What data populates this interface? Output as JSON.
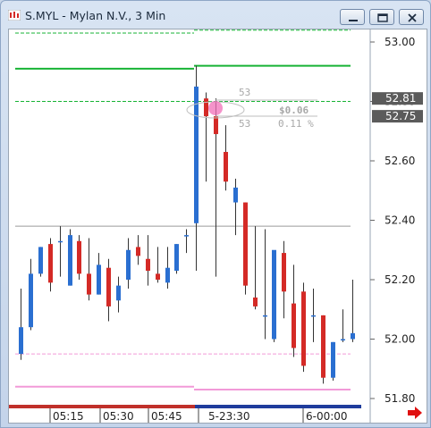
{
  "window": {
    "title": "S.MYL - Mylan N.V., 3 Min",
    "buttons": [
      "minimize",
      "maximize",
      "close"
    ]
  },
  "colors": {
    "up_candle": "#2a6fd1",
    "down_candle": "#d42a26",
    "green_level": "#17b334",
    "pink_level": "#f29ad8",
    "price_tag_bg": "#5b5b5b",
    "session_bar_red": "#c0302a",
    "session_bar_blue": "#1f3c9c",
    "arrow": "#e01010"
  },
  "chart_data": {
    "type": "candlestick",
    "symbol": "S.MYL",
    "interval": "3 Min",
    "y_axis": {
      "ylim": [
        51.76,
        53.06
      ],
      "ticks": [
        "53.00",
        "52.80",
        "52.60",
        "52.40",
        "52.20",
        "52.00",
        "51.80"
      ],
      "price_tags": [
        "52.81",
        "52.75"
      ]
    },
    "x_axis": {
      "ticks": [
        "05:15",
        "05:30",
        "05:45",
        "5-23:30",
        "6-00:00"
      ]
    },
    "candles": [
      {
        "o": 51.95,
        "h": 52.17,
        "l": 51.93,
        "c": 52.04
      },
      {
        "o": 52.04,
        "h": 52.27,
        "l": 52.03,
        "c": 52.22
      },
      {
        "o": 52.22,
        "h": 52.31,
        "l": 52.21,
        "c": 52.31
      },
      {
        "o": 52.32,
        "h": 52.34,
        "l": 52.16,
        "c": 52.19
      },
      {
        "o": 52.33,
        "h": 52.38,
        "l": 52.21,
        "c": 52.33
      },
      {
        "o": 52.18,
        "h": 52.37,
        "l": 52.18,
        "c": 52.35
      },
      {
        "o": 52.33,
        "h": 52.35,
        "l": 52.2,
        "c": 52.22
      },
      {
        "o": 52.22,
        "h": 52.34,
        "l": 52.13,
        "c": 52.15
      },
      {
        "o": 52.15,
        "h": 52.29,
        "l": 52.15,
        "c": 52.25
      },
      {
        "o": 52.24,
        "h": 52.27,
        "l": 52.06,
        "c": 52.11
      },
      {
        "o": 52.13,
        "h": 52.21,
        "l": 52.09,
        "c": 52.18
      },
      {
        "o": 52.2,
        "h": 52.34,
        "l": 52.17,
        "c": 52.3
      },
      {
        "o": 52.31,
        "h": 52.35,
        "l": 52.25,
        "c": 52.28
      },
      {
        "o": 52.27,
        "h": 52.35,
        "l": 52.18,
        "c": 52.23
      },
      {
        "o": 52.22,
        "h": 52.31,
        "l": 52.19,
        "c": 52.2
      },
      {
        "o": 52.19,
        "h": 52.31,
        "l": 52.17,
        "c": 52.24
      },
      {
        "o": 52.23,
        "h": 52.32,
        "l": 52.22,
        "c": 52.32
      },
      {
        "o": 52.35,
        "h": 52.37,
        "l": 52.29,
        "c": 52.35
      },
      {
        "o": 52.39,
        "h": 52.92,
        "l": 52.23,
        "c": 52.85
      },
      {
        "o": 52.81,
        "h": 52.83,
        "l": 52.53,
        "c": 52.75
      },
      {
        "o": 52.75,
        "h": 52.81,
        "l": 52.21,
        "c": 52.69
      },
      {
        "o": 52.63,
        "h": 52.72,
        "l": 52.5,
        "c": 52.53
      },
      {
        "o": 52.46,
        "h": 52.54,
        "l": 52.35,
        "c": 52.51
      },
      {
        "o": 52.46,
        "h": 52.46,
        "l": 52.15,
        "c": 52.18
      },
      {
        "o": 52.14,
        "h": 52.38,
        "l": 52.1,
        "c": 52.11
      },
      {
        "o": 52.08,
        "h": 52.37,
        "l": 52.0,
        "c": 52.08
      },
      {
        "o": 52.0,
        "h": 52.26,
        "l": 51.99,
        "c": 52.3
      },
      {
        "o": 52.29,
        "h": 52.33,
        "l": 52.07,
        "c": 52.16
      },
      {
        "o": 52.12,
        "h": 52.25,
        "l": 51.94,
        "c": 51.97
      },
      {
        "o": 52.16,
        "h": 52.19,
        "l": 51.89,
        "c": 51.91
      },
      {
        "o": 52.08,
        "h": 52.17,
        "l": 51.99,
        "c": 52.08
      },
      {
        "o": 52.08,
        "h": 52.08,
        "l": 51.85,
        "c": 51.87
      },
      {
        "o": 51.87,
        "h": 51.99,
        "l": 51.86,
        "c": 51.99
      },
      {
        "o": 52.0,
        "h": 52.1,
        "l": 51.99,
        "c": 52.0
      },
      {
        "o": 52.0,
        "h": 52.2,
        "l": 51.99,
        "c": 52.02
      }
    ],
    "levels": [
      {
        "name": "green-upper-dashed-left",
        "price": 53.03,
        "style": "dashed",
        "color": "green",
        "segment": "left"
      },
      {
        "name": "green-upper-dashed-right",
        "price": 53.04,
        "style": "dashed",
        "color": "green",
        "segment": "right"
      },
      {
        "name": "green-solid-left",
        "price": 52.91,
        "style": "solid",
        "color": "green",
        "segment": "left"
      },
      {
        "name": "green-solid-right",
        "price": 52.92,
        "style": "solid",
        "color": "green",
        "segment": "right"
      },
      {
        "name": "green-lower-dashed",
        "price": 52.8,
        "style": "dashed",
        "color": "green",
        "segment": "full"
      },
      {
        "name": "gray-reference",
        "price": 52.38,
        "style": "solid",
        "color": "gray",
        "segment": "full"
      },
      {
        "name": "pink-dashed",
        "price": 51.95,
        "style": "dashed",
        "color": "pink",
        "segment": "full"
      },
      {
        "name": "pink-solid-left",
        "price": 51.84,
        "style": "solid",
        "color": "pink",
        "segment": "left"
      },
      {
        "name": "pink-solid-right",
        "price": 51.83,
        "style": "solid",
        "color": "pink",
        "segment": "right"
      }
    ],
    "annotation": {
      "top_label": "53",
      "change": "$0.06",
      "bottom_label": "53",
      "percent": "0.11 %"
    }
  }
}
